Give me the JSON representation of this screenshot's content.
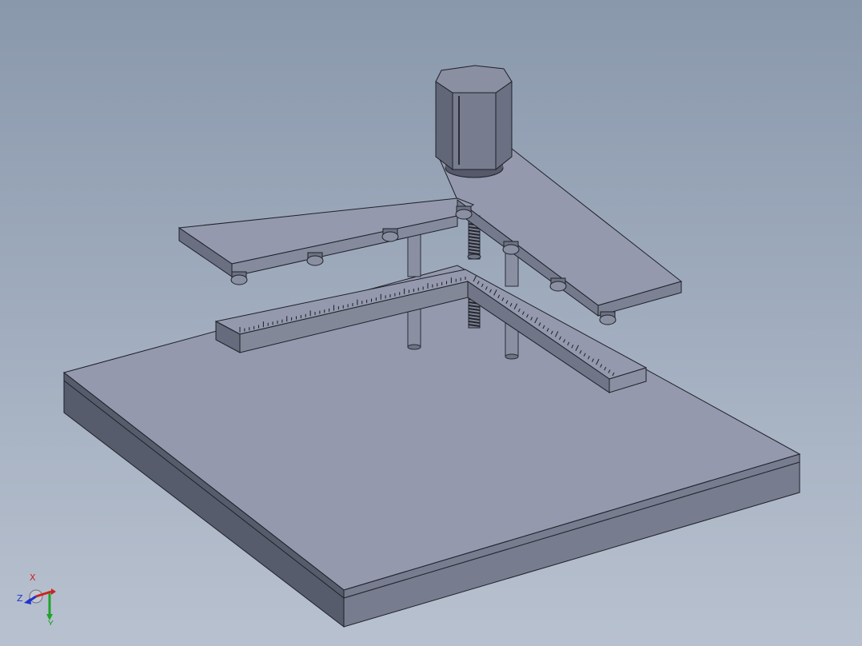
{
  "viewport": {
    "background_top": "#8a98ac",
    "background_bottom": "#b8c1cf",
    "model_color": "#9499ad"
  },
  "triad": {
    "x_label": "X",
    "y_label": "Y",
    "z_label": "Z",
    "x_color": "#cc2222",
    "y_color": "#1fa32a",
    "z_color": "#2233cc"
  }
}
